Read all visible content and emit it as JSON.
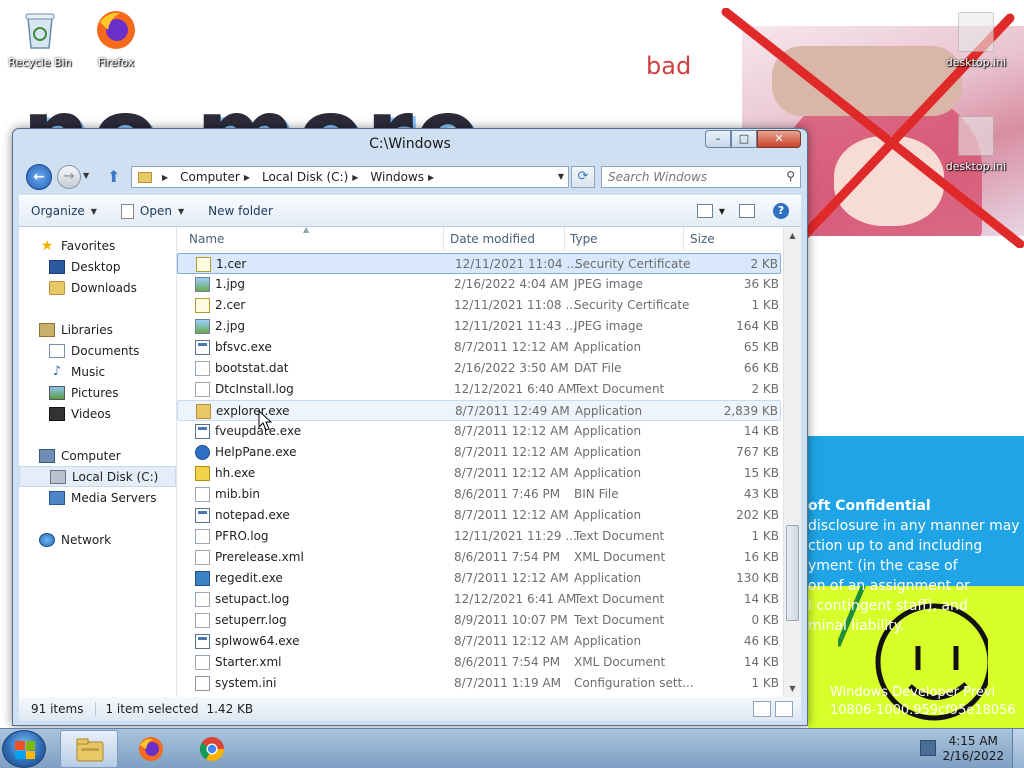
{
  "desktop": {
    "icons": [
      {
        "label": "Recycle Bin"
      },
      {
        "label": "Firefox"
      },
      {
        "label": "desktop.ini"
      },
      {
        "label": "desktop.ini"
      }
    ],
    "wallpaper_text": "no more",
    "bad_text": "bad",
    "confidential": {
      "lines": [
        "oft Confidential",
        "disclosure in any manner may",
        "ction up to and including",
        "yment (in the case of",
        "on of an assignment or",
        "l contingent staff), and",
        "minal liability."
      ],
      "footer_lines": [
        "Windows Developer Previ",
        "10806-1000.959cf95e18056"
      ]
    }
  },
  "window": {
    "title": "C:\\Windows",
    "controls": {
      "minimize": "–",
      "maximize": "□",
      "close": "✕"
    },
    "address": {
      "crumbs": [
        "Computer",
        "Local Disk (C:)",
        "Windows"
      ]
    },
    "search_placeholder": "Search Windows",
    "toolbar": {
      "organize": "Organize",
      "open": "Open",
      "new_folder": "New folder"
    },
    "nav": {
      "favorites": "Favorites",
      "favorites_items": [
        "Desktop",
        "Downloads"
      ],
      "libraries": "Libraries",
      "libraries_items": [
        "Documents",
        "Music",
        "Pictures",
        "Videos"
      ],
      "computer": "Computer",
      "computer_items": [
        "Local Disk (C:)",
        "Media Servers"
      ],
      "network": "Network"
    },
    "columns": {
      "name": "Name",
      "date": "Date modified",
      "type": "Type",
      "size": "Size"
    },
    "files": [
      {
        "name": "1.cer",
        "date": "12/11/2021 11:04 ...",
        "type": "Security Certificate",
        "size": "2 KB",
        "icon": "cert-icon"
      },
      {
        "name": "1.jpg",
        "date": "2/16/2022 4:04 AM",
        "type": "JPEG image",
        "size": "36 KB",
        "icon": "image-icon"
      },
      {
        "name": "2.cer",
        "date": "12/11/2021 11:08 ...",
        "type": "Security Certificate",
        "size": "1 KB",
        "icon": "cert-icon"
      },
      {
        "name": "2.jpg",
        "date": "12/11/2021 11:43 ...",
        "type": "JPEG image",
        "size": "164 KB",
        "icon": "image-icon"
      },
      {
        "name": "bfsvc.exe",
        "date": "8/7/2011 12:12 AM",
        "type": "Application",
        "size": "65 KB",
        "icon": "app-icon"
      },
      {
        "name": "bootstat.dat",
        "date": "2/16/2022 3:50 AM",
        "type": "DAT File",
        "size": "66 KB",
        "icon": "dat-file-icon"
      },
      {
        "name": "DtcInstall.log",
        "date": "12/12/2021 6:40 AM",
        "type": "Text Document",
        "size": "2 KB",
        "icon": "text-doc-icon"
      },
      {
        "name": "explorer.exe",
        "date": "8/7/2011 12:49 AM",
        "type": "Application",
        "size": "2,839 KB",
        "icon": "explorer-icon"
      },
      {
        "name": "fveupdate.exe",
        "date": "8/7/2011 12:12 AM",
        "type": "Application",
        "size": "14 KB",
        "icon": "app-icon"
      },
      {
        "name": "HelpPane.exe",
        "date": "8/7/2011 12:12 AM",
        "type": "Application",
        "size": "767 KB",
        "icon": "help-icon"
      },
      {
        "name": "hh.exe",
        "date": "8/7/2011 12:12 AM",
        "type": "Application",
        "size": "15 KB",
        "icon": "hh-icon"
      },
      {
        "name": "mib.bin",
        "date": "8/6/2011 7:46 PM",
        "type": "BIN File",
        "size": "43 KB",
        "icon": "bin-file-icon"
      },
      {
        "name": "notepad.exe",
        "date": "8/7/2011 12:12 AM",
        "type": "Application",
        "size": "202 KB",
        "icon": "app-icon"
      },
      {
        "name": "PFRO.log",
        "date": "12/11/2021 11:29 ...",
        "type": "Text Document",
        "size": "1 KB",
        "icon": "text-doc-icon"
      },
      {
        "name": "Prerelease.xml",
        "date": "8/6/2011 7:54 PM",
        "type": "XML Document",
        "size": "16 KB",
        "icon": "xml-doc-icon"
      },
      {
        "name": "regedit.exe",
        "date": "8/7/2011 12:12 AM",
        "type": "Application",
        "size": "130 KB",
        "icon": "regedit-icon"
      },
      {
        "name": "setupact.log",
        "date": "12/12/2021 6:41 AM",
        "type": "Text Document",
        "size": "14 KB",
        "icon": "text-doc-icon"
      },
      {
        "name": "setuperr.log",
        "date": "8/9/2011 10:07 PM",
        "type": "Text Document",
        "size": "0 KB",
        "icon": "text-doc-icon"
      },
      {
        "name": "splwow64.exe",
        "date": "8/7/2011 12:12 AM",
        "type": "Application",
        "size": "46 KB",
        "icon": "app-icon"
      },
      {
        "name": "Starter.xml",
        "date": "8/6/2011 7:54 PM",
        "type": "XML Document",
        "size": "14 KB",
        "icon": "xml-doc-icon"
      },
      {
        "name": "system.ini",
        "date": "8/7/2011 1:19 AM",
        "type": "Configuration sett...",
        "size": "1 KB",
        "icon": "ini-file-icon"
      }
    ],
    "status": {
      "count": "91 items",
      "selected": "1 item selected",
      "size": "1.42 KB"
    }
  },
  "taskbar": {
    "time": "4:15 AM",
    "date": "2/16/2022"
  }
}
